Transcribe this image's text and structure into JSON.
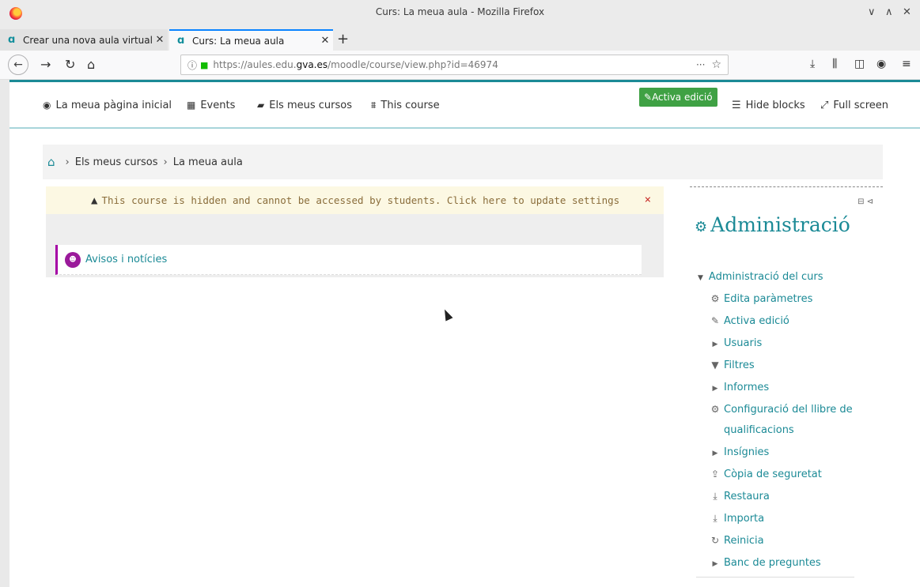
{
  "window": {
    "title": "Curs: La meua aula - Mozilla Firefox",
    "controls": [
      "∨",
      "∧",
      "✕"
    ]
  },
  "tabs": [
    {
      "label": "Crear una nova aula virtual",
      "active": false
    },
    {
      "label": "Curs: La meua aula",
      "active": true
    }
  ],
  "toolbar": {
    "url_prefix": "https://aules.edu.",
    "url_domain": "gva.es",
    "url_suffix": "/moodle/course/view.php?id=46974",
    "more": "···",
    "star": "☆"
  },
  "moodle_nav": {
    "items": [
      {
        "icon": "dashboard-icon",
        "glyph": "◉",
        "label": "La meua pàgina inicial"
      },
      {
        "icon": "calendar-icon",
        "glyph": "▦",
        "label": "Events"
      },
      {
        "icon": "briefcase-icon",
        "glyph": "▰",
        "label": "Els meus cursos"
      },
      {
        "icon": "sitemap-icon",
        "glyph": "⩩",
        "label": "This course"
      }
    ],
    "edit_button": "Activa edició",
    "hide_blocks": "Hide blocks",
    "full_screen": "Full screen"
  },
  "breadcrumb": {
    "items": [
      "Els meus cursos",
      "La meua aula"
    ],
    "sep": "›"
  },
  "alert": {
    "message": "This course is hidden and cannot be accessed by students. Click here to update settings",
    "close": "×"
  },
  "section": {
    "forum": "Avisos i notícies"
  },
  "admin": {
    "title": "Administració",
    "tree_root": "Administració del curs",
    "items": [
      {
        "label": "Edita paràmetres",
        "icon": "gear-icon",
        "glyph": "⚙",
        "type": "leaf"
      },
      {
        "label": "Activa edició",
        "icon": "pencil-icon",
        "glyph": "✎",
        "type": "leaf"
      },
      {
        "label": "Usuaris",
        "icon": "expand-icon",
        "glyph": "▶",
        "type": "branch"
      },
      {
        "label": "Filtres",
        "icon": "filter-icon",
        "glyph": "▼",
        "type": "leaf"
      },
      {
        "label": "Informes",
        "icon": "expand-icon",
        "glyph": "▶",
        "type": "branch"
      },
      {
        "label": "Configuració del llibre de",
        "label2": "qualificacions",
        "icon": "gear-icon",
        "glyph": "⚙",
        "type": "leaf"
      },
      {
        "label": "Insígnies",
        "icon": "expand-icon",
        "glyph": "▶",
        "type": "branch"
      },
      {
        "label": "Còpia de seguretat",
        "icon": "upload-icon",
        "glyph": "⇪",
        "type": "leaf"
      },
      {
        "label": "Restaura",
        "icon": "download-icon",
        "glyph": "⤓",
        "type": "leaf"
      },
      {
        "label": "Importa",
        "icon": "download-icon",
        "glyph": "⤓",
        "type": "leaf"
      },
      {
        "label": "Reinicia",
        "icon": "reset-icon",
        "glyph": "↻",
        "type": "leaf"
      },
      {
        "label": "Banc de preguntes",
        "icon": "expand-icon",
        "glyph": "▶",
        "type": "branch"
      }
    ]
  }
}
